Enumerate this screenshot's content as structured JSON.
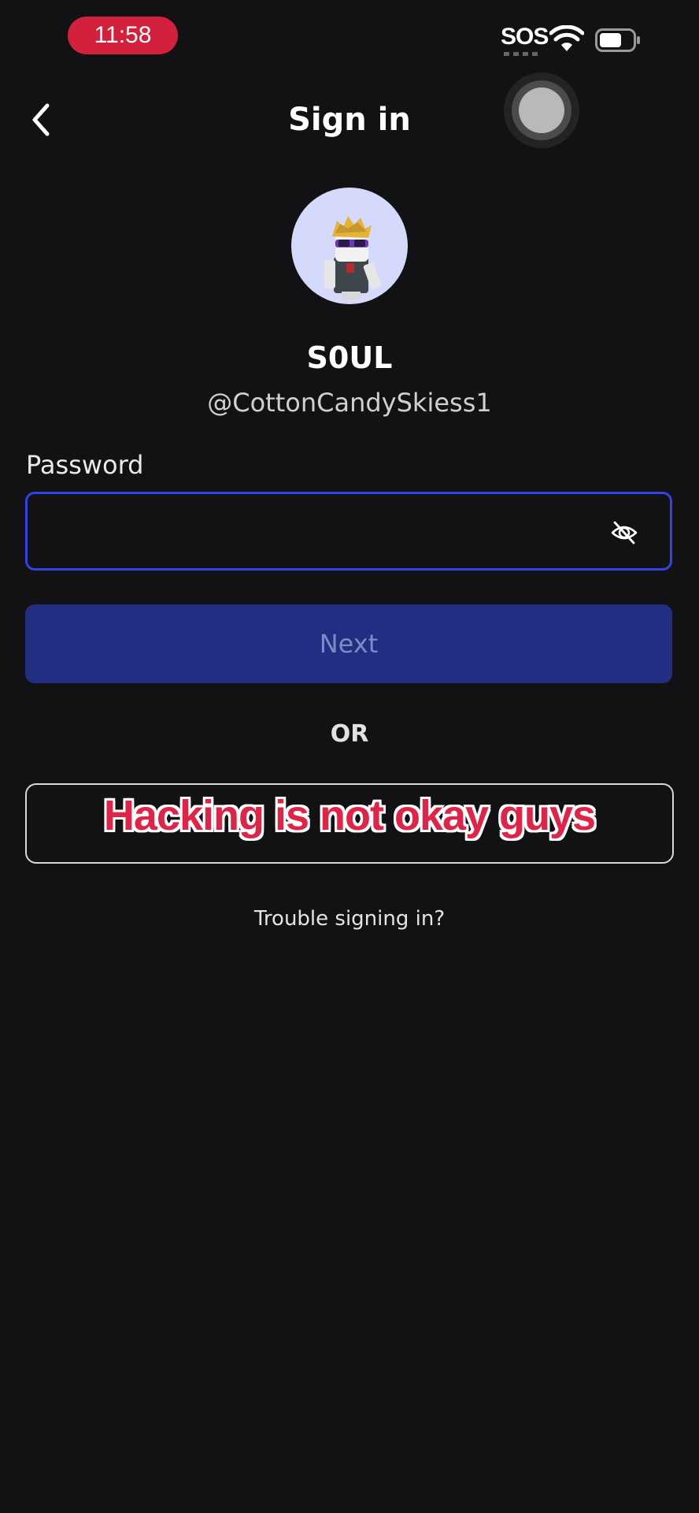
{
  "status_bar": {
    "time": "11:58",
    "sos": "SOS"
  },
  "header": {
    "title": "Sign in"
  },
  "profile": {
    "display_name": "S0UL",
    "username": "@CottonCandySkiess1"
  },
  "password": {
    "label": "Password",
    "value": "",
    "placeholder": ""
  },
  "actions": {
    "next_label": "Next",
    "or_label": "OR",
    "alternate_label": "",
    "trouble_label": "Trouble signing in?"
  },
  "overlay": {
    "caption": "Hacking is not okay guys"
  },
  "colors": {
    "background": "#121215",
    "accent": "#3043e6",
    "next_button": "#212e82",
    "time_pill": "#d3203d",
    "caption": "#e02447"
  },
  "icons": {
    "back": "chevron-left-icon",
    "eye": "eye-off-icon",
    "wifi": "wifi-icon",
    "battery": "battery-icon"
  }
}
